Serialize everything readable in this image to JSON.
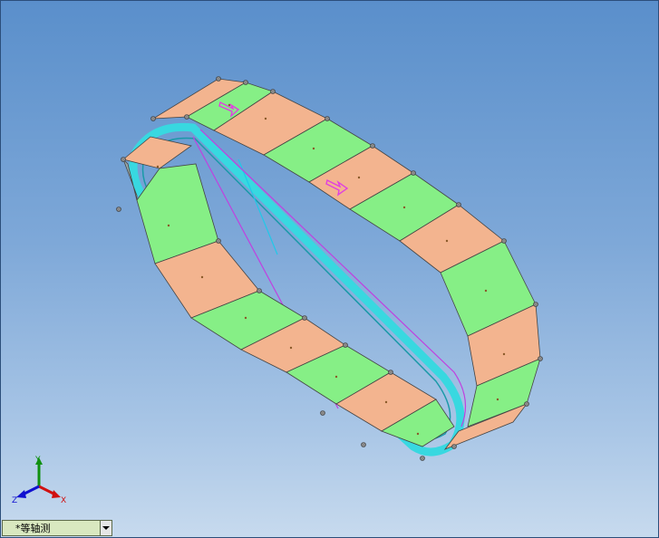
{
  "viewport": {
    "background_top": "#5a8fcb",
    "background_bottom": "#c7daee"
  },
  "model": {
    "panel_color_a": "#f3b48f",
    "panel_color_b": "#86ef86",
    "rail_color": "#38d8e0",
    "line_magenta": "#c040e0",
    "line_cyan": "#20c8e8"
  },
  "triad": {
    "x_label": "X",
    "y_label": "Y",
    "z_label": "Z",
    "x_color": "#d01010",
    "y_color": "#109010",
    "z_color": "#1010d0"
  },
  "view_selector": {
    "value": "*等轴测",
    "dropdown_icon": "chevron-down-icon"
  }
}
